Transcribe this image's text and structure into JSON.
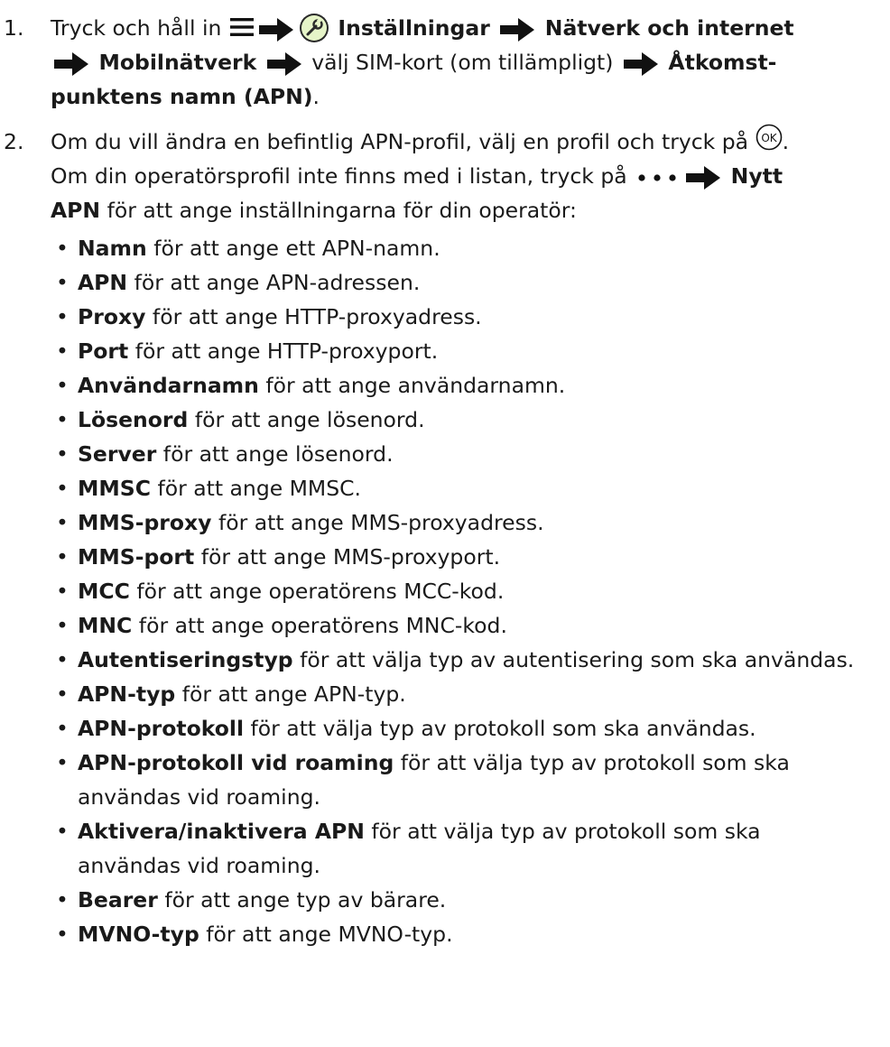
{
  "step1": {
    "num": "1.",
    "text_a": "Tryck och håll in",
    "setting": "Inställningar",
    "network": "Nätverk och internet",
    "mobile": "Mobilnätverk",
    "text_b": "välj SIM-kort (om tillämpligt)",
    "apn": "Åtkomst-punktens namn (APN)",
    "apn_line1": "Åtkomst-",
    "apn_line2a": "punktens namn (",
    "apn_line2b": "APN",
    "apn_line2c": ")",
    "period": ".",
    "icons": [
      "menu-icon",
      "arrow-right-icon",
      "settings-icon"
    ]
  },
  "step2": {
    "num": "2.",
    "text_a": "Om du vill ändra en befintlig APN-profil, välj en profil och tryck på",
    "text_a_end": ".",
    "text_b": "Om din operatörsprofil inte finns med i listan, tryck på",
    "new_apn": "Nytt APN",
    "new_apn_1": "Nytt",
    "new_apn_2": "APN",
    "text_c": "för att ange inställningarna för din operatör:",
    "icons": [
      "ok-icon",
      "more-dots-icon"
    ]
  },
  "options": [
    {
      "term": "Namn",
      "desc": "för att ange ett APN-namn."
    },
    {
      "term": "APN",
      "desc": "för att ange APN-adressen."
    },
    {
      "term": "Proxy",
      "desc": "för att ange HTTP-proxyadress."
    },
    {
      "term": "Port",
      "desc": "för att ange HTTP-proxyport."
    },
    {
      "term": "Användarnamn",
      "desc": "för att ange användarnamn."
    },
    {
      "term": "Lösenord",
      "desc": "för att ange lösenord."
    },
    {
      "term": "Server",
      "desc": "för att ange lösenord."
    },
    {
      "term": "MMSC",
      "desc": "för att ange MMSC."
    },
    {
      "term": "MMS-proxy",
      "desc": "för att ange MMS-proxyadress."
    },
    {
      "term": "MMS-port",
      "desc": "för att ange MMS-proxyport."
    },
    {
      "term": "MCC",
      "desc": "för att ange operatörens MCC-kod."
    },
    {
      "term": "MNC",
      "desc": "för att ange operatörens MNC-kod."
    },
    {
      "term": "Autentiseringstyp",
      "desc": "för att välja typ av autentisering som ska användas."
    },
    {
      "term": "APN-typ",
      "desc": "för att ange APN-typ."
    },
    {
      "term": "APN-protokoll",
      "desc": "för att välja typ av protokoll som ska användas."
    },
    {
      "term": "APN-protokoll vid roaming",
      "desc": "för att välja typ av protokoll som ska användas vid roaming."
    },
    {
      "term": "Aktivera/inaktivera APN",
      "desc": "för att välja typ av protokoll som ska användas vid roaming."
    },
    {
      "term": "Bearer",
      "desc": "för att ange typ av bärare."
    },
    {
      "term": "MVNO-typ",
      "desc": "för att ange MVNO-typ."
    }
  ]
}
